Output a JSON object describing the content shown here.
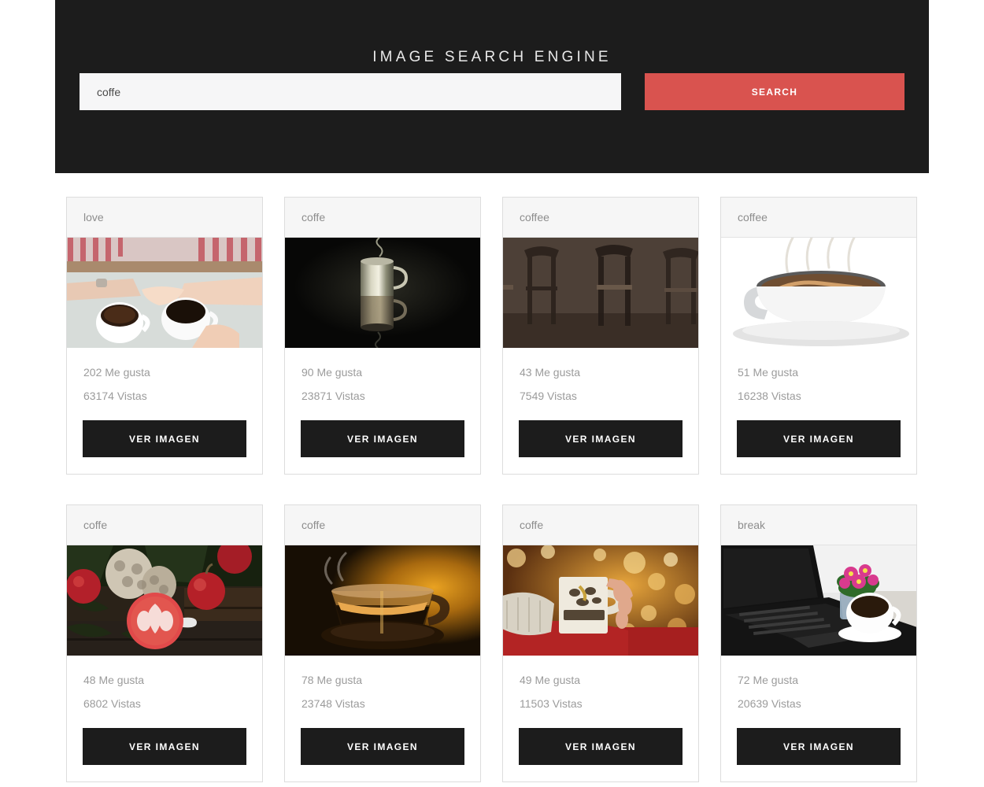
{
  "hero": {
    "title": "IMAGE SEARCH ENGINE",
    "search": {
      "value": "coffe",
      "placeholder": "coffe",
      "button_label": "SEARCH"
    },
    "background_color": "#1c1c1c",
    "accent_color": "#d9534f"
  },
  "labels": {
    "likes_suffix": "Me gusta",
    "views_suffix": "Vistas",
    "view_image": "VER IMAGEN"
  },
  "results": [
    {
      "tag": "love",
      "likes": "202 Me gusta",
      "views": "63174 Vistas",
      "button": "VER IMAGEN",
      "likes_count": 202,
      "views_count": 63174,
      "image_alt": "two-hands-holding-coffee-cups"
    },
    {
      "tag": "coffe",
      "likes": "90 Me gusta",
      "views": "23871 Vistas",
      "button": "VER IMAGEN",
      "likes_count": 90,
      "views_count": 23871,
      "image_alt": "metal-mug-dark-background"
    },
    {
      "tag": "coffee",
      "likes": "43 Me gusta",
      "views": "7549 Vistas",
      "button": "VER IMAGEN",
      "likes_count": 43,
      "views_count": 7549,
      "image_alt": "cafe-bar-stools-blurred"
    },
    {
      "tag": "coffee",
      "likes": "51 Me gusta",
      "views": "16238 Vistas",
      "button": "VER IMAGEN",
      "likes_count": 51,
      "views_count": 16238,
      "image_alt": "illustrated-latte-cup-steaming"
    },
    {
      "tag": "coffe",
      "likes": "48 Me gusta",
      "views": "6802 Vistas",
      "button": "VER IMAGEN",
      "likes_count": 48,
      "views_count": 6802,
      "image_alt": "christmas-latte-apples-pinecones"
    },
    {
      "tag": "coffe",
      "likes": "78 Me gusta",
      "views": "23748 Vistas",
      "button": "VER IMAGEN",
      "likes_count": 78,
      "views_count": 23748,
      "image_alt": "glass-espresso-cup-amber-light"
    },
    {
      "tag": "coffe",
      "likes": "49 Me gusta",
      "views": "11503 Vistas",
      "button": "VER IMAGEN",
      "likes_count": 49,
      "views_count": 11503,
      "image_alt": "hands-holding-mug-bokeh-lights"
    },
    {
      "tag": "break",
      "likes": "72 Me gusta",
      "views": "20639 Vistas",
      "button": "VER IMAGEN",
      "likes_count": 72,
      "views_count": 20639,
      "image_alt": "laptop-coffee-cup-flowers-desk"
    }
  ]
}
